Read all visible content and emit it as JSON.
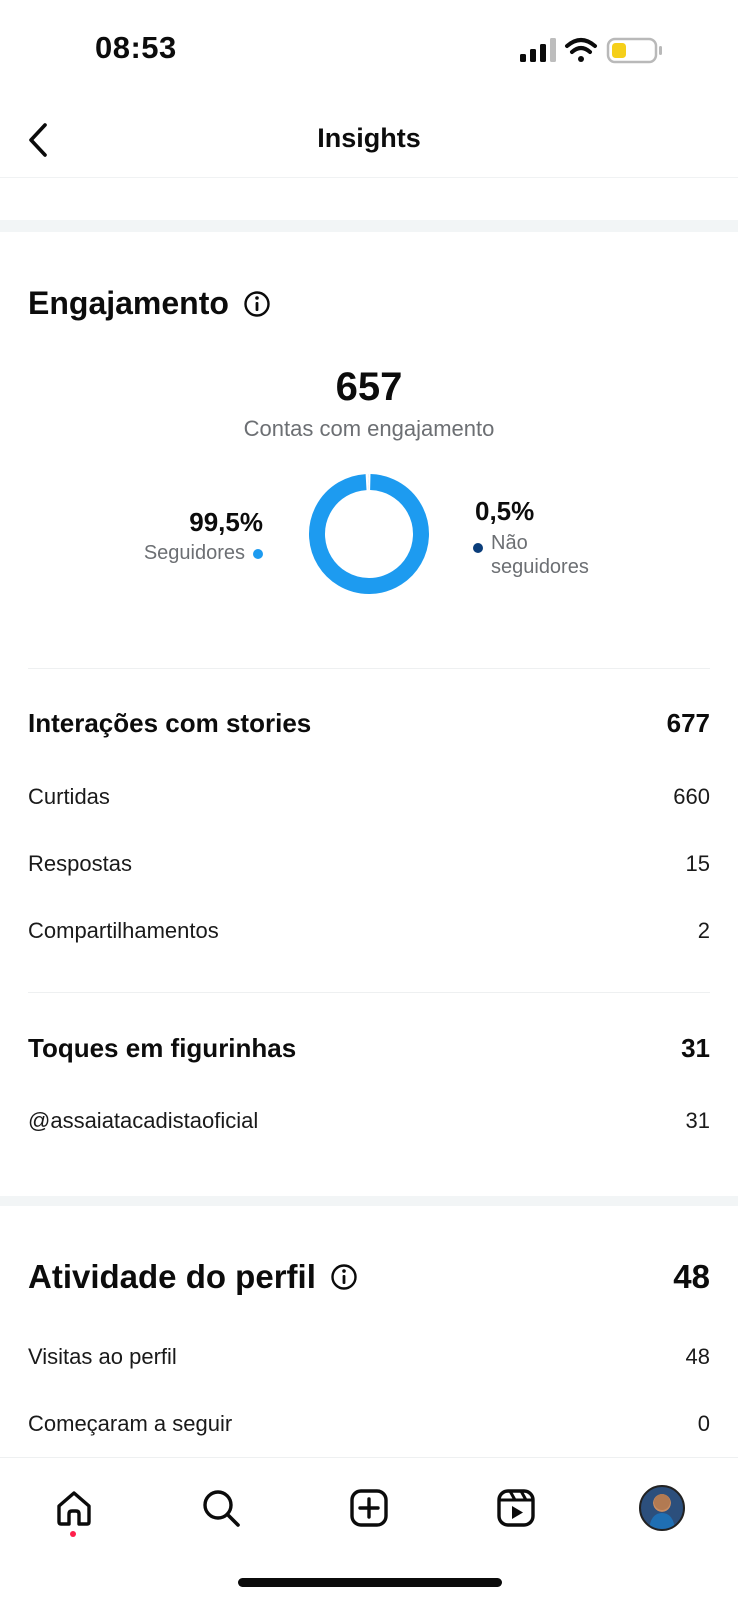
{
  "status_bar": {
    "time": "08:53"
  },
  "nav": {
    "title": "Insights"
  },
  "engagement": {
    "title": "Engajamento",
    "total": "657",
    "subtitle": "Contas com engajamento",
    "followers_pct": "99,5%",
    "followers_label": "Seguidores",
    "non_followers_pct": "0,5%",
    "non_followers_label": "Não seguidores",
    "followers_color": "#1d9bf0",
    "non_followers_color": "#0a3d7a"
  },
  "chart_data": {
    "type": "pie",
    "categories": [
      "Seguidores",
      "Não seguidores"
    ],
    "values": [
      99.5,
      0.5
    ],
    "title": "",
    "center_label": "657"
  },
  "story_interactions": {
    "title": "Interações com stories",
    "total": "677",
    "items": [
      {
        "label": "Curtidas",
        "value": "660"
      },
      {
        "label": "Respostas",
        "value": "15"
      },
      {
        "label": "Compartilhamentos",
        "value": "2"
      }
    ]
  },
  "sticker_taps": {
    "title": "Toques em figurinhas",
    "total": "31",
    "items": [
      {
        "label": "@assaiatacadistaoficial",
        "value": "31"
      }
    ]
  },
  "profile_activity": {
    "title": "Atividade do perfil",
    "total": "48",
    "items": [
      {
        "label": "Visitas ao perfil",
        "value": "48"
      },
      {
        "label": "Começaram a seguir",
        "value": "0"
      }
    ]
  },
  "tabbar": {
    "icons": [
      "home-icon",
      "search-icon",
      "create-icon",
      "reels-icon",
      "profile-avatar"
    ]
  }
}
